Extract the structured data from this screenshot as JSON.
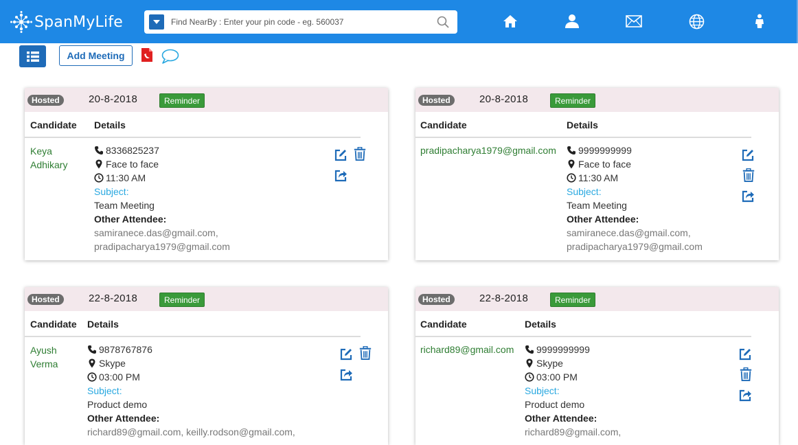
{
  "header": {
    "logo_text": "SpanMyLife",
    "search_placeholder": "Find NearBy : Enter your pin code - eg. 560037",
    "nav": [
      "home-icon",
      "user-icon",
      "mail-icon",
      "globe-icon",
      "person-icon"
    ],
    "brand_color": "#1E88E5"
  },
  "toolbar": {
    "add_meeting_label": "Add Meeting"
  },
  "meetings": [
    {
      "hosted": "Hosted",
      "date": "20-8-2018",
      "reminder": "Reminder",
      "col_candidate": "Candidate",
      "col_details": "Details",
      "candidate_line1": "Keya",
      "candidate_line2": "Adhikary",
      "phone": "8336825237",
      "mode": "Face to face",
      "time": "11:30 AM",
      "subject_label": "Subject:",
      "subject": "Team Meeting",
      "attendee_label": "Other Attendee:",
      "attendee_line1": "samiranece.das@gmail.com,",
      "attendee_line2": "pradipacharya1979@gmail.com"
    },
    {
      "hosted": "Hosted",
      "date": "20-8-2018",
      "reminder": "Reminder",
      "col_candidate": "Candidate",
      "col_details": "Details",
      "candidate_line1": "pradipacharya1979@gmail.com",
      "candidate_line2": "",
      "phone": "9999999999",
      "mode": "Face to face",
      "time": "11:30 AM",
      "subject_label": "Subject:",
      "subject": "Team Meeting",
      "attendee_label": "Other Attendee:",
      "attendee_line1": "samiranece.das@gmail.com,",
      "attendee_line2": "pradipacharya1979@gmail.com"
    },
    {
      "hosted": "Hosted",
      "date": "22-8-2018",
      "reminder": "Reminder",
      "col_candidate": "Candidate",
      "col_details": "Details",
      "candidate_line1": "Ayush",
      "candidate_line2": "Verma",
      "phone": "9878767876",
      "mode": "Skype",
      "time": "03:00 PM",
      "subject_label": "Subject:",
      "subject": "Product demo",
      "attendee_label": "Other Attendee:",
      "attendee_line1": "richard89@gmail.com, keilly.rodson@gmail.com,",
      "attendee_line2": ""
    },
    {
      "hosted": "Hosted",
      "date": "22-8-2018",
      "reminder": "Reminder",
      "col_candidate": "Candidate",
      "col_details": "Details",
      "candidate_line1": "richard89@gmail.com",
      "candidate_line2": "",
      "phone": "9999999999",
      "mode": "Skype",
      "time": "03:00 PM",
      "subject_label": "Subject:",
      "subject": "Product demo",
      "attendee_label": "Other Attendee:",
      "attendee_line1": "richard89@gmail.com,",
      "attendee_line2": ""
    }
  ]
}
